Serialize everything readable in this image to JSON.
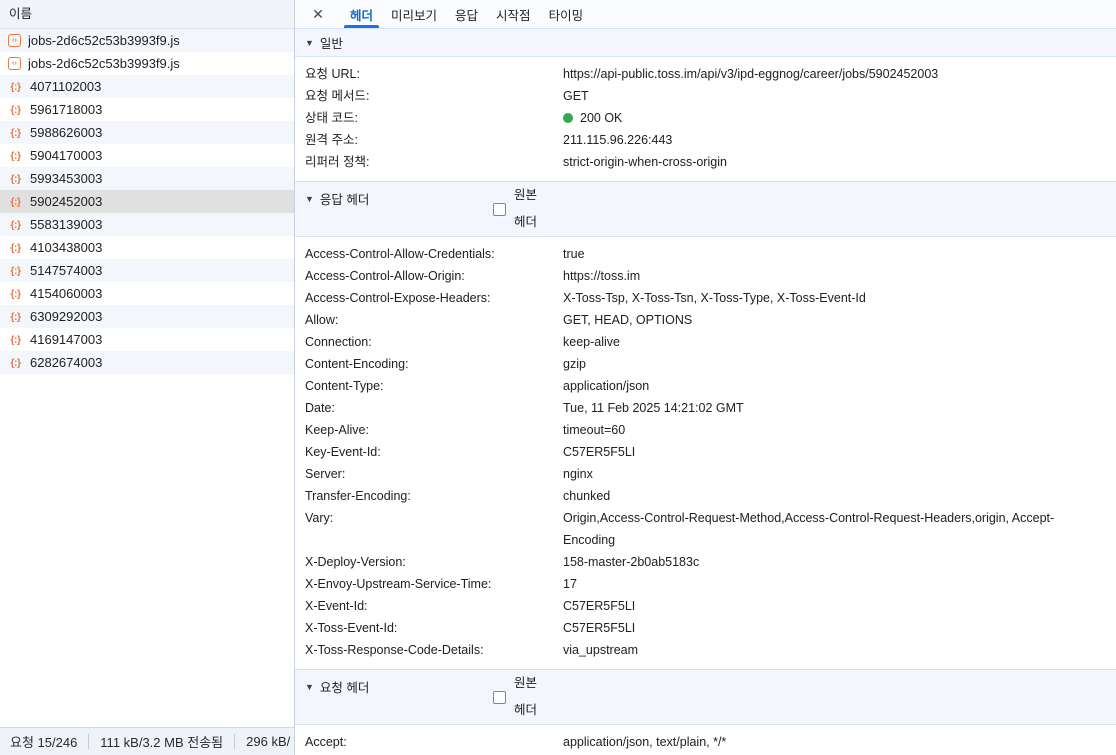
{
  "icons": {
    "close": "✕",
    "collapse": "▼",
    "script": "‹›",
    "fetch": "{:}"
  },
  "colors": {
    "accent_blue": "#1a73e8",
    "status_green": "#34a853",
    "icon_orange": "#e8793f",
    "selected_row": "#e0e0e0",
    "stripe_row": "#f3f7fb",
    "section_band": "#f3f7fd"
  },
  "left_panel": {
    "header": "이름",
    "rows": [
      {
        "name": "jobs-2d6c52c53b3993f9.js",
        "icon": "script",
        "selected": false
      },
      {
        "name": "jobs-2d6c52c53b3993f9.js",
        "icon": "script",
        "selected": false
      },
      {
        "name": "4071102003",
        "icon": "fetch",
        "selected": false
      },
      {
        "name": "5961718003",
        "icon": "fetch",
        "selected": false
      },
      {
        "name": "5988626003",
        "icon": "fetch",
        "selected": false
      },
      {
        "name": "5904170003",
        "icon": "fetch",
        "selected": false
      },
      {
        "name": "5993453003",
        "icon": "fetch",
        "selected": false
      },
      {
        "name": "5902452003",
        "icon": "fetch",
        "selected": true
      },
      {
        "name": "5583139003",
        "icon": "fetch",
        "selected": false
      },
      {
        "name": "4103438003",
        "icon": "fetch",
        "selected": false
      },
      {
        "name": "5147574003",
        "icon": "fetch",
        "selected": false
      },
      {
        "name": "4154060003",
        "icon": "fetch",
        "selected": false
      },
      {
        "name": "6309292003",
        "icon": "fetch",
        "selected": false
      },
      {
        "name": "4169147003",
        "icon": "fetch",
        "selected": false
      },
      {
        "name": "6282674003",
        "icon": "fetch",
        "selected": false
      }
    ],
    "status_bar": {
      "requests": "요청 15/246",
      "transferred": "111 kB/3.2 MB 전송됨",
      "resources": "296 kB/"
    }
  },
  "details_panel": {
    "tabs": [
      {
        "id": "headers",
        "label": "헤더",
        "active": true
      },
      {
        "id": "preview",
        "label": "미리보기",
        "active": false
      },
      {
        "id": "response",
        "label": "응답",
        "active": false
      },
      {
        "id": "initiator",
        "label": "시작점",
        "active": false
      },
      {
        "id": "timing",
        "label": "타이밍",
        "active": false
      }
    ],
    "sections": {
      "general": {
        "title": "일반",
        "rows": [
          {
            "name": "요청 URL:",
            "value": "https://api-public.toss.im/api/v3/ipd-eggnog/career/jobs/5902452003"
          },
          {
            "name": "요청 메서드:",
            "value": "GET"
          },
          {
            "name": "상태 코드:",
            "value": "200 OK",
            "status_dot": true
          },
          {
            "name": "원격 주소:",
            "value": "211.115.96.226:443"
          },
          {
            "name": "리퍼러 정책:",
            "value": "strict-origin-when-cross-origin"
          }
        ]
      },
      "response_headers": {
        "title": "응답 헤더",
        "raw_toggle": {
          "line1": "원본",
          "line2": "헤더",
          "checked": false
        },
        "rows": [
          {
            "name": "Access-Control-Allow-Credentials:",
            "value": "true"
          },
          {
            "name": "Access-Control-Allow-Origin:",
            "value": "https://toss.im"
          },
          {
            "name": "Access-Control-Expose-Headers:",
            "value": "X-Toss-Tsp, X-Toss-Tsn, X-Toss-Type, X-Toss-Event-Id"
          },
          {
            "name": "Allow:",
            "value": "GET, HEAD, OPTIONS"
          },
          {
            "name": "Connection:",
            "value": "keep-alive"
          },
          {
            "name": "Content-Encoding:",
            "value": "gzip"
          },
          {
            "name": "Content-Type:",
            "value": "application/json"
          },
          {
            "name": "Date:",
            "value": "Tue, 11 Feb 2025 14:21:02 GMT"
          },
          {
            "name": "Keep-Alive:",
            "value": "timeout=60"
          },
          {
            "name": "Key-Event-Id:",
            "value": "C57ER5F5LI"
          },
          {
            "name": "Server:",
            "value": "nginx"
          },
          {
            "name": "Transfer-Encoding:",
            "value": "chunked"
          },
          {
            "name": "Vary:",
            "value": "Origin,Access-Control-Request-Method,Access-Control-Request-Headers,origin, Accept-Encoding"
          },
          {
            "name": "X-Deploy-Version:",
            "value": "158-master-2b0ab5183c"
          },
          {
            "name": "X-Envoy-Upstream-Service-Time:",
            "value": "17"
          },
          {
            "name": "X-Event-Id:",
            "value": "C57ER5F5LI"
          },
          {
            "name": "X-Toss-Event-Id:",
            "value": "C57ER5F5LI"
          },
          {
            "name": "X-Toss-Response-Code-Details:",
            "value": "via_upstream"
          }
        ]
      },
      "request_headers": {
        "title": "요청 헤더",
        "raw_toggle": {
          "line1": "원본",
          "line2": "헤더",
          "checked": false
        },
        "rows": [
          {
            "name": "Accept:",
            "value": "application/json, text/plain, */*"
          }
        ]
      }
    }
  }
}
